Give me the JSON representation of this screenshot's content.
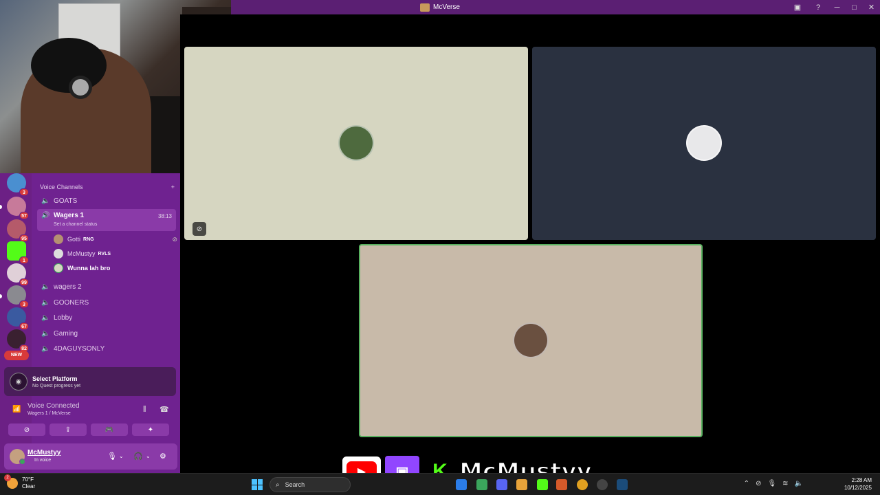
{
  "window": {
    "title": "McVerse"
  },
  "guilds": [
    {
      "badge": "3"
    },
    {
      "badge": "57"
    },
    {
      "badge": "95"
    },
    {
      "badge": "1"
    },
    {
      "badge": "99"
    },
    {
      "badge": "3"
    },
    {
      "badge": "67"
    },
    {
      "badge": "82"
    }
  ],
  "guild_new_label": "NEW",
  "channels": {
    "category": "Voice Channels",
    "items": [
      {
        "name": "GOATS"
      },
      {
        "name": "Wagers 1",
        "timer": "38:13",
        "status": "Set a channel status"
      },
      {
        "name": "wagers 2"
      },
      {
        "name": "GOONERS"
      },
      {
        "name": "Lobby"
      },
      {
        "name": "Gaming"
      },
      {
        "name": "4DAGUYSONLY"
      }
    ],
    "members": [
      {
        "name": "Gotti",
        "tag": "RNG"
      },
      {
        "name": "McMustyy",
        "tag": "RVLS"
      },
      {
        "name": "Wunna lah bro",
        "tag": ""
      }
    ]
  },
  "quest": {
    "title": "Select Platform",
    "subtitle": "No Quest progress yet"
  },
  "voice": {
    "title": "Voice Connected",
    "subtitle": "Wagers 1 / McVerse"
  },
  "user": {
    "name": "McMustyy",
    "status": "In voice"
  },
  "overlay": {
    "name": "McMustyy"
  },
  "taskbar": {
    "weather_temp": "70°F",
    "weather_desc": "Clear",
    "weather_badge": "2",
    "search_placeholder": "Search",
    "time": "2:28 AM",
    "date": "10/12/2025"
  }
}
